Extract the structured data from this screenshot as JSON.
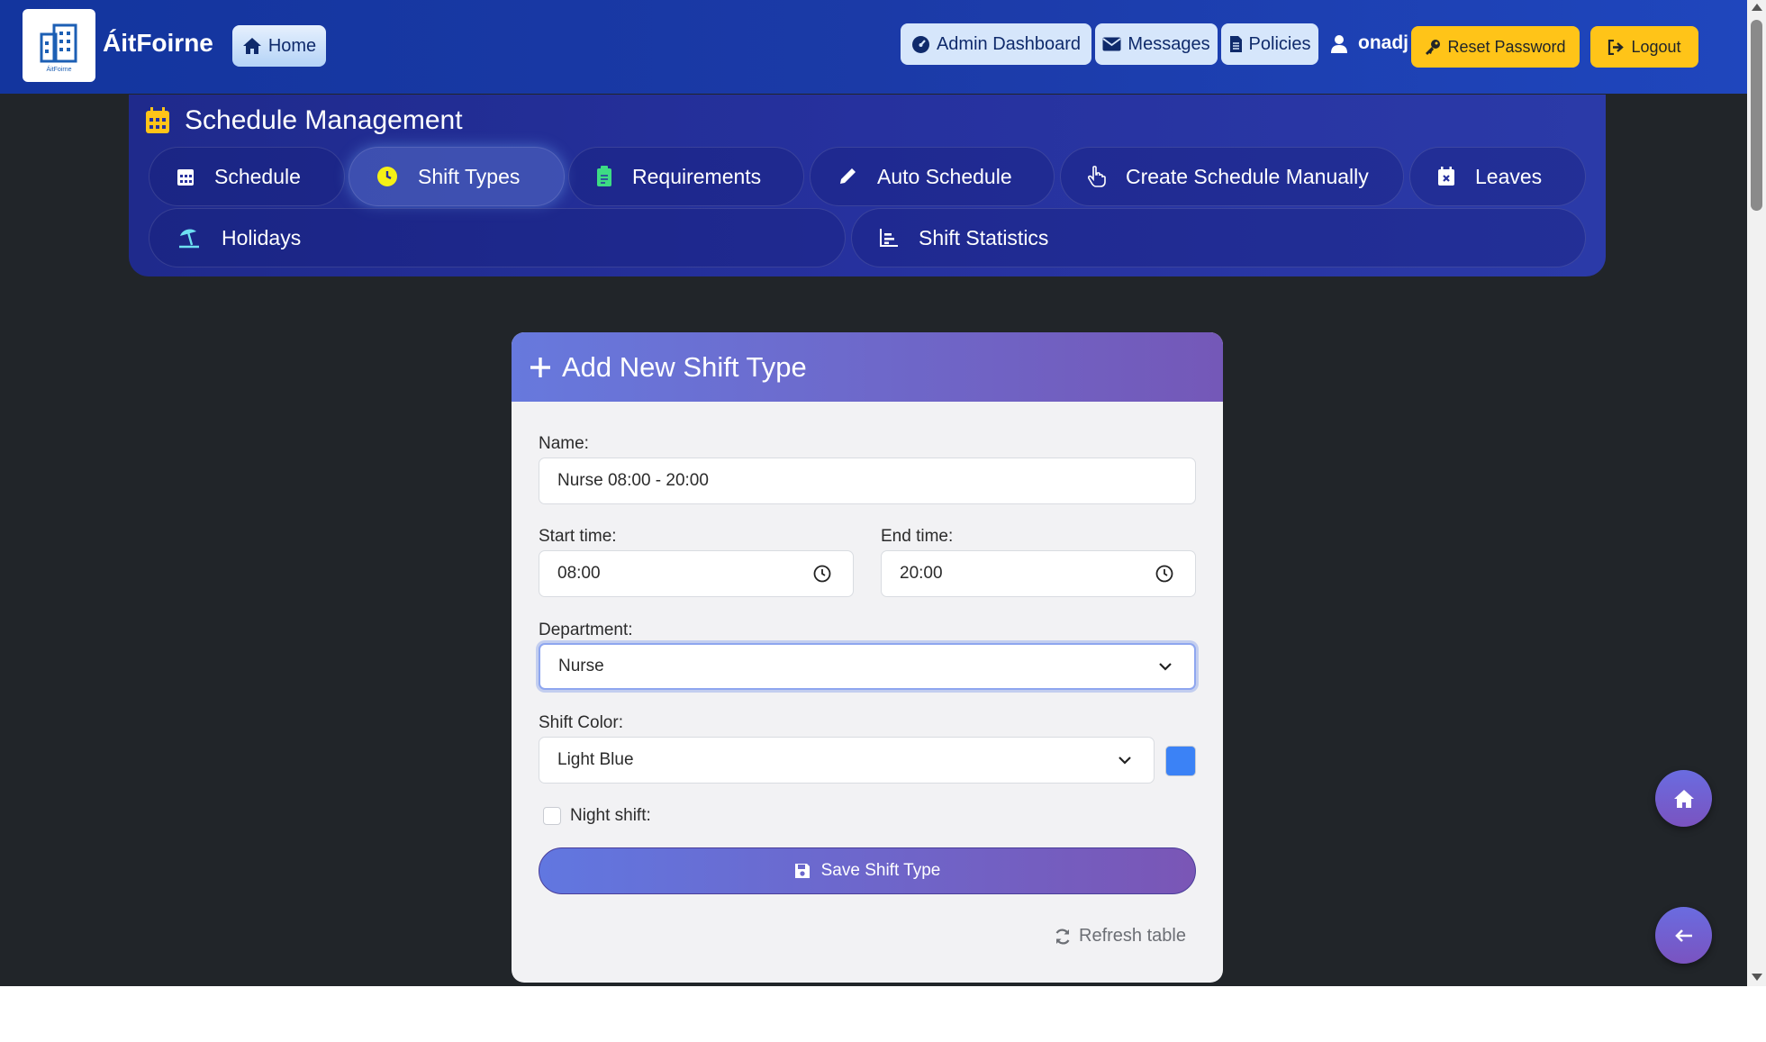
{
  "navbar": {
    "brand": "ÁitFoirne",
    "logo_text": "ÁitFoirne",
    "home_label": "Home",
    "admin_dashboard_label": "Admin Dashboard",
    "messages_label": "Messages",
    "policies_label": "Policies",
    "username": "onadj",
    "reset_password_label": "Reset Password",
    "logout_label": "Logout"
  },
  "schedule_panel": {
    "title": "Schedule Management",
    "tabs": [
      {
        "label": "Schedule",
        "icon": "calendar-icon"
      },
      {
        "label": "Shift Types",
        "icon": "clock-icon",
        "active": true
      },
      {
        "label": "Requirements",
        "icon": "clipboard-icon"
      },
      {
        "label": "Auto Schedule",
        "icon": "pencil-icon"
      },
      {
        "label": "Create Schedule Manually",
        "icon": "hand-pointer-icon"
      },
      {
        "label": "Leaves",
        "icon": "calendar-x-icon"
      },
      {
        "label": "Holidays",
        "icon": "umbrella-beach-icon"
      },
      {
        "label": "Shift Statistics",
        "icon": "bar-chart-icon"
      }
    ]
  },
  "form": {
    "header": "Add New Shift Type",
    "name_label": "Name:",
    "name_value": "Nurse 08:00 - 20:00",
    "start_label": "Start time:",
    "start_value": "08:00",
    "end_label": "End time:",
    "end_value": "20:00",
    "department_label": "Department:",
    "department_value": "Nurse",
    "color_label": "Shift Color:",
    "color_value": "Light Blue",
    "color_swatch": "#3b82f6",
    "night_label": "Night shift:",
    "night_checked": false,
    "save_label": "Save Shift Type",
    "refresh_label": "Refresh table"
  },
  "colors": {
    "navbar": "#1b3aa7",
    "panel": "#26319e",
    "accent_yellow": "#ffc418",
    "card_header_start": "#6779dd",
    "card_header_end": "#7458b8",
    "page_bg": "#212529"
  }
}
